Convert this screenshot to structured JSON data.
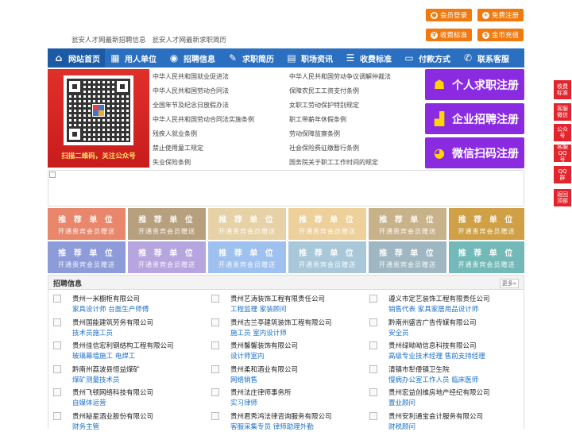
{
  "top": {
    "links": [
      "瓮安人才网最新招聘信息",
      "瓮安人才网最新求职简历"
    ],
    "buttons": [
      {
        "label": "会员登录",
        "icon": "user-icon"
      },
      {
        "label": "免费注册",
        "icon": "user-add-icon"
      },
      {
        "label": "收费标准",
        "icon": "price-icon"
      },
      {
        "label": "金币充值",
        "icon": "coin-icon"
      }
    ]
  },
  "nav": {
    "items": [
      {
        "label": "网站首页",
        "icon": "home-icon"
      },
      {
        "label": "用人单位",
        "icon": "building-icon"
      },
      {
        "label": "招聘信息",
        "icon": "megaphone-icon"
      },
      {
        "label": "求职简历",
        "icon": "resume-icon"
      },
      {
        "label": "职场资讯",
        "icon": "news-icon"
      },
      {
        "label": "收费标准",
        "icon": "price-icon"
      },
      {
        "label": "付款方式",
        "icon": "wallet-icon"
      },
      {
        "label": "联系客服",
        "icon": "phone-icon"
      }
    ]
  },
  "qr": {
    "caption": "扫描二维码，关注公众号"
  },
  "laws": {
    "left": [
      "中华人民共和国就业促进法",
      "中华人民共和国劳动合同法",
      "全国年节及纪念日放假办法",
      "中华人民共和国劳动合同法实施条例",
      "残疾人就业条例",
      "禁止使用童工规定",
      "失业保险条例"
    ],
    "right": [
      "中华人民共和国劳动争议调解仲裁法",
      "保障农民工工资支付条例",
      "女职工劳动保护特别规定",
      "职工带薪年休假条例",
      "劳动保障监察条例",
      "社会保险费征缴暂行条例",
      "国务院关于职工工作时间的规定"
    ]
  },
  "register": [
    {
      "label": "个人求职注册",
      "icon": "person-icon"
    },
    {
      "label": "企业招聘注册",
      "icon": "company-icon"
    },
    {
      "label": "微信扫码注册",
      "icon": "wechat-icon"
    }
  ],
  "tiles": {
    "title": "推 荐 单 位",
    "subtitle": "开通贵宾会员赠送",
    "colors": [
      "#e8876b",
      "#b7a07e",
      "#e6d2a6",
      "#edd09a",
      "#c7b28a",
      "#cfa046",
      "#8d9bd8",
      "#b6a5df",
      "#9fc1ef",
      "#a8c8da",
      "#9fb7c3",
      "#73b9b8"
    ]
  },
  "jobs": {
    "title": "招聘信息",
    "more": "更多»",
    "columns": [
      [
        {
          "company": "贵州一米橱柜有限公司",
          "positions": "家具设计师 台面生产师傅"
        },
        {
          "company": "贵州国能建筑劳务有限公司",
          "positions": "技术员施工员"
        },
        {
          "company": "贵州佳信宏利钢结构工程有限公司",
          "positions": "玻璃幕墙施工 电焊工"
        },
        {
          "company": "黔南州荔波县恒益煤矿",
          "positions": "煤矿测量技术员"
        },
        {
          "company": "贵州飞顿网络科技有限公司",
          "positions": "自媒体运营"
        },
        {
          "company": "贵州秘星酒业股份有限公司",
          "positions": "财务主管"
        }
      ],
      [
        {
          "company": "贵州艺涛装饰工程有限责任公司",
          "positions": "工程监理 家装顾问"
        },
        {
          "company": "贵州古兰亭建筑装饰工程有限公司",
          "positions": "施工员 室内设计师"
        },
        {
          "company": "贵州馨馨装饰有限公司",
          "positions": "设计师室内"
        },
        {
          "company": "贵州柔和酒业有限公司",
          "positions": "网络销售"
        },
        {
          "company": "贵州法庄律师事务所",
          "positions": "实习律师"
        },
        {
          "company": "贵州君秀鸿法律咨询服务有限公司",
          "positions": "客服采集专员 律师助理外勤"
        }
      ],
      [
        {
          "company": "遵义市定艺装饰工程有限责任公司",
          "positions": "销售代表 家具家居用品设计师"
        },
        {
          "company": "黔南州盛吉广告传媒有限公司",
          "positions": "安全员"
        },
        {
          "company": "贵州绿呦呦信息科技有限公司",
          "positions": "高级专业技术经理 售前支持经理"
        },
        {
          "company": "清镇市犁倭镇卫生院",
          "positions": "慢病办公室工作人员 临床医师"
        },
        {
          "company": "贵州宏益创维房地产经纪有限公司",
          "positions": "置业顾问"
        },
        {
          "company": "贵州安利通宝会计服务有限公司",
          "positions": "财税顾问"
        }
      ]
    ]
  },
  "side": [
    "收费标准",
    "客服微信",
    "公众号",
    "客服QQ号",
    "QQ群",
    "返回顶部"
  ]
}
